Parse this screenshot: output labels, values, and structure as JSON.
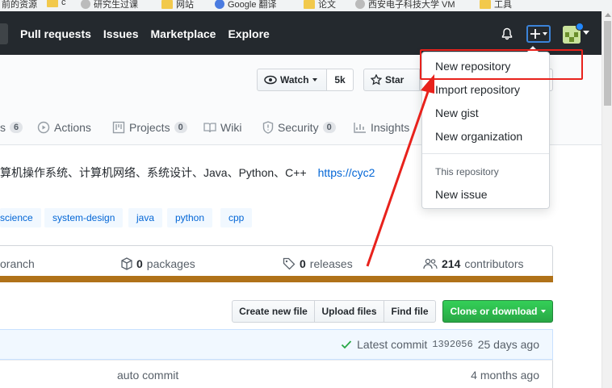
{
  "browser": {
    "bookmarks": [
      "前的资源",
      "c",
      "研究生过课",
      "网站",
      "Google 翻译",
      "论文",
      "西安电子科技大学 VM",
      "工具"
    ]
  },
  "header": {
    "nav": [
      "Pull requests",
      "Issues",
      "Marketplace",
      "Explore"
    ]
  },
  "repo": {
    "watch_label": "Watch",
    "watch_count": "5k",
    "star_label": "Star",
    "tabs": [
      {
        "label": "s",
        "count": "6"
      },
      {
        "label": "Actions",
        "count": ""
      },
      {
        "label": "Projects",
        "count": "0"
      },
      {
        "label": "Wiki",
        "count": ""
      },
      {
        "label": "Security",
        "count": "0"
      },
      {
        "label": "Insights",
        "count": ""
      }
    ],
    "description": "算机操作系统、计算机网络、系统设计、Java、Python、C++",
    "link": "https://cyc2",
    "topics": [
      "science",
      "system-design",
      "java",
      "python",
      "cpp"
    ],
    "summary": {
      "branch_label": "oranch",
      "packages_count": "0",
      "packages_label": "packages",
      "releases_count": "0",
      "releases_label": "releases",
      "contributors_count": "214",
      "contributors_label": "contributors"
    },
    "language_color": "#b07219",
    "file_buttons": {
      "create": "Create new file",
      "upload": "Upload files",
      "find": "Find file",
      "clone": "Clone or download"
    },
    "commit": {
      "label": "Latest commit",
      "sha": "1392056",
      "age": "25 days ago"
    },
    "rows": [
      {
        "message": "auto commit",
        "age": "4 months ago"
      }
    ]
  },
  "dropdown": {
    "items": [
      "New repository",
      "Import repository",
      "New gist",
      "New organization"
    ],
    "section_header": "This repository",
    "section_items": [
      "New issue"
    ]
  },
  "annotation_color": "#e8221c"
}
